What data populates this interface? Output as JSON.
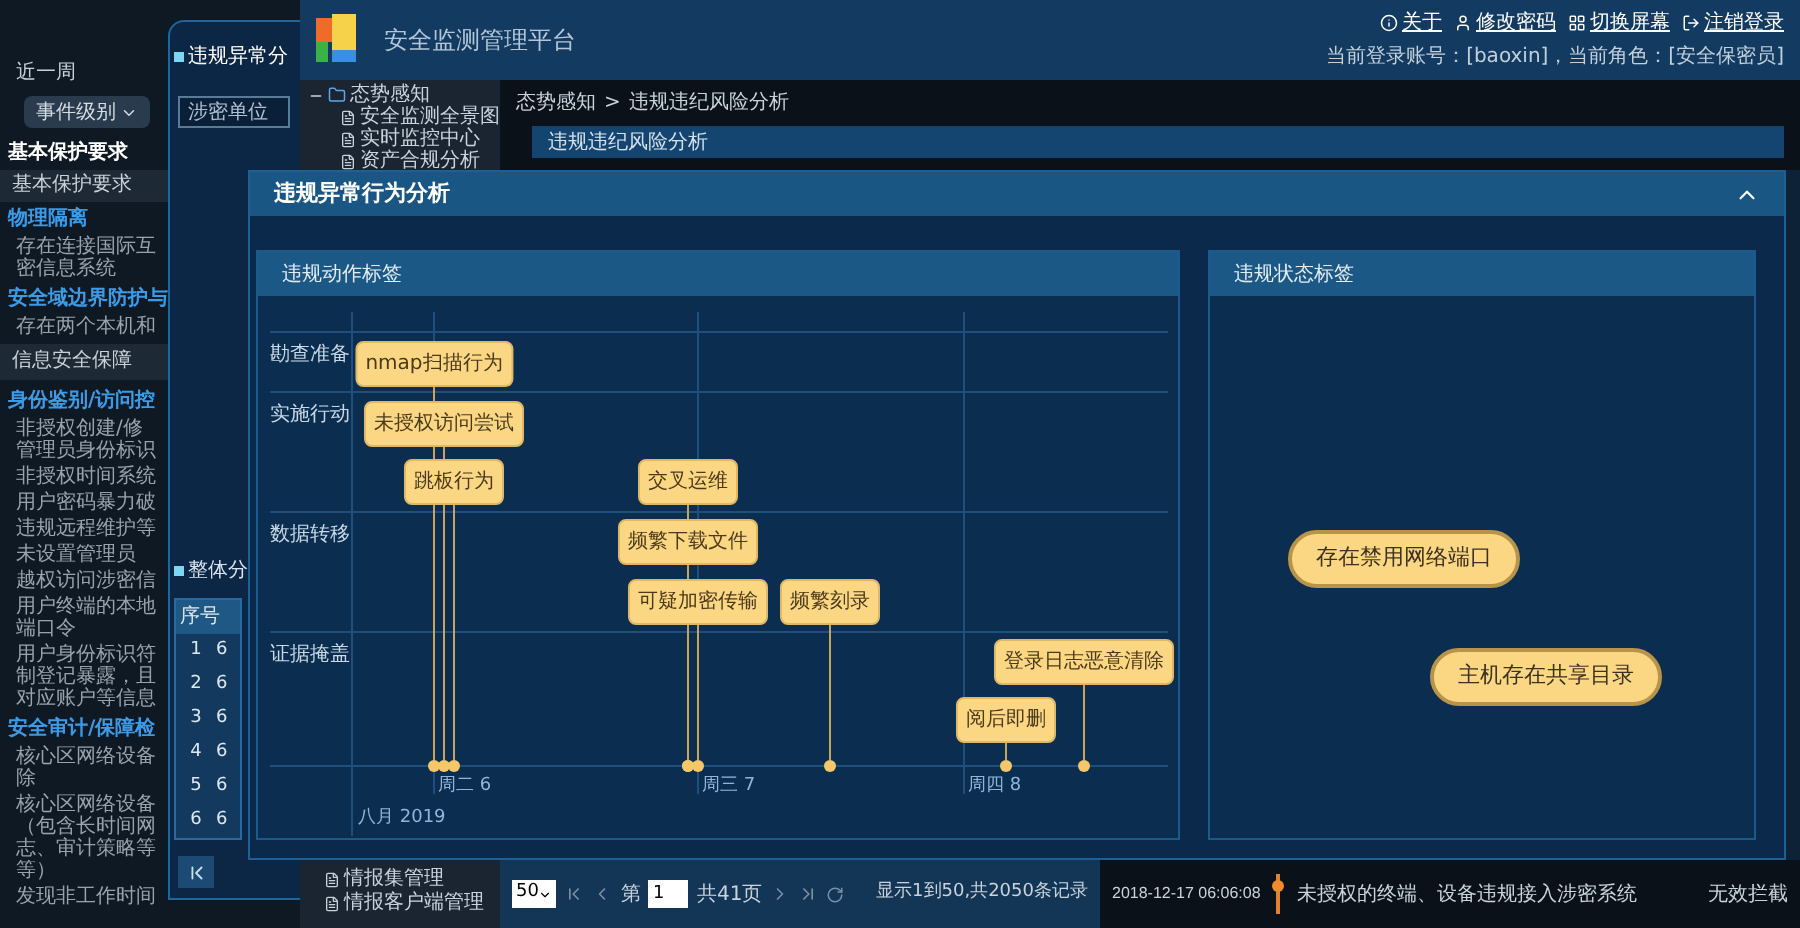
{
  "filter_panel": {
    "period_tab": "近一周",
    "level_dropdown": "事件级别",
    "heading": "基本保护要求",
    "subheading": "基本保护要求",
    "entries": [
      {
        "kind": "category",
        "lines": [
          "物理隔离"
        ]
      },
      {
        "kind": "item",
        "lines": [
          "存在连接国际互",
          "密信息系统"
        ]
      },
      {
        "kind": "category",
        "lines": [
          "安全域边界防护与"
        ]
      },
      {
        "kind": "item",
        "lines": [
          "存在两个本机和"
        ]
      },
      {
        "kind": "group",
        "lines": [
          "信息安全保障"
        ]
      },
      {
        "kind": "category",
        "lines": [
          "身份鉴别/访问控"
        ]
      },
      {
        "kind": "item",
        "lines": [
          "非授权创建/修",
          "管理员身份标识"
        ]
      },
      {
        "kind": "item",
        "lines": [
          "非授权时间系统"
        ]
      },
      {
        "kind": "item",
        "lines": [
          "用户密码暴力破"
        ]
      },
      {
        "kind": "item",
        "lines": [
          "违规远程维护等"
        ]
      },
      {
        "kind": "item",
        "lines": [
          "未设置管理员"
        ]
      },
      {
        "kind": "item",
        "lines": [
          "越权访问涉密信"
        ]
      },
      {
        "kind": "item",
        "lines": [
          "用户终端的本地",
          "端口令"
        ]
      },
      {
        "kind": "item",
        "lines": [
          "用户身份标识符",
          "制登记暴露，且",
          "对应账户等信息"
        ]
      },
      {
        "kind": "category",
        "lines": [
          "安全审计/保障检"
        ]
      },
      {
        "kind": "item",
        "lines": [
          "核心区网络设备",
          "除"
        ]
      },
      {
        "kind": "item",
        "lines": [
          "核心区网络设备",
          "（包含长时间网",
          "志、审计策略等",
          "等）"
        ]
      },
      {
        "kind": "item",
        "lines": [
          "发现非工作时间"
        ]
      }
    ]
  },
  "analysis_window": {
    "title": "违规异常分",
    "unit_field": {
      "placeholder": "涉密单位"
    },
    "overall": {
      "title": "整体分",
      "table": {
        "columns": [
          "序号"
        ],
        "rows": [
          {
            "cells": [
              "1",
              "6"
            ]
          },
          {
            "cells": [
              "2",
              "6"
            ]
          },
          {
            "cells": [
              "3",
              "6"
            ]
          },
          {
            "cells": [
              "4",
              "6"
            ]
          },
          {
            "cells": [
              "5",
              "6"
            ]
          },
          {
            "cells": [
              "6",
              "6"
            ]
          }
        ]
      }
    }
  },
  "platform": {
    "title": "安全监测管理平台",
    "header_links": [
      "关于",
      "修改密码",
      "切换屏幕",
      "注销登录"
    ],
    "account": "当前登录账号：[baoxin]，当前角色：[安全保密员]",
    "tree": [
      {
        "label": "态势感知",
        "expanded": true,
        "children": [
          {
            "label": "安全监测全景图"
          },
          {
            "label": "实时监控中心"
          },
          {
            "label": "资产合规分析"
          }
        ]
      }
    ],
    "breadcrumb": {
      "items": [
        "态势感知",
        "违规违纪风险分析"
      ],
      "separator": ">"
    },
    "panel_title": "违规违纪风险分析",
    "bottom_tree": [
      {
        "label": "情报集管理"
      },
      {
        "label": "情报客户端管理"
      }
    ],
    "pager": {
      "page_size": "50",
      "page_prefix": "第",
      "page": "1",
      "pages": "共41页",
      "summary": "显示1到50,共2050条记录"
    },
    "log_row": {
      "time": "2018-12-17 06:06:08",
      "message": "未授权的终端、设备违规接入涉密系统",
      "status": "无效拦截"
    }
  },
  "modal": {
    "title": "违规异常行为分析",
    "action_panel": {
      "title": "违规动作标签",
      "timeline": {
        "groups": [
          {
            "label": "勘查准备",
            "items": [
              "nmap扫描行为"
            ]
          },
          {
            "label": "实施行动",
            "items": [
              "未授权访问尝试",
              "跳板行为",
              "交叉运维"
            ]
          },
          {
            "label": "数据转移",
            "items": [
              "频繁下载文件",
              "可疑加密传输",
              "频繁刻录"
            ]
          },
          {
            "label": "证据掩盖",
            "items": [
              "登录日志恶意清除",
              "阅后即删"
            ]
          }
        ],
        "ticks": [
          "周二 6",
          "周三 7",
          "周四 8"
        ],
        "month": "八月 2019"
      }
    },
    "state_panel": {
      "title": "违规状态标签",
      "tags": [
        "存在禁用网络端口",
        "主机存在共享目录"
      ]
    }
  }
}
